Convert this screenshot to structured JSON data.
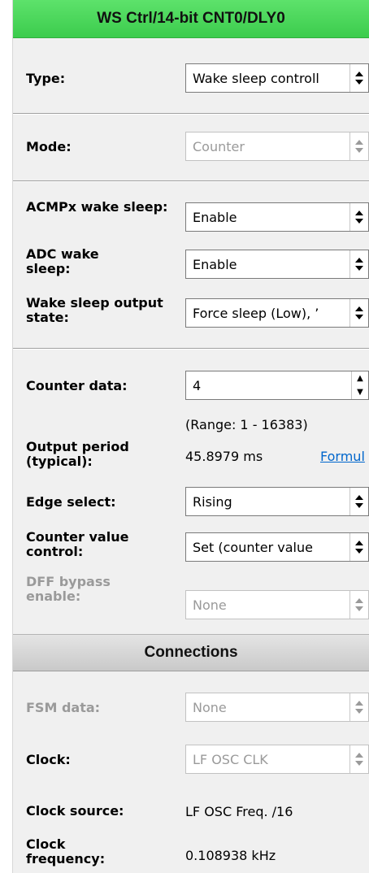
{
  "header": {
    "title": "WS Ctrl/14-bit CNT0/DLY0"
  },
  "type_row": {
    "label": "Type:",
    "value": "Wake sleep controll"
  },
  "mode_row": {
    "label": "Mode:",
    "value": "Counter"
  },
  "acmp_row": {
    "label": "ACMPx wake sleep:",
    "value": "Enable"
  },
  "adc_row": {
    "label": "ADC wake sleep:",
    "value": "Enable"
  },
  "output_state_row": {
    "label": "Wake sleep output state:",
    "value": "Force sleep (Low), ’"
  },
  "counter_data_row": {
    "label": "Counter data:",
    "value": "4",
    "range": "(Range:  1 - 16383)"
  },
  "output_period_row": {
    "label": "Output period (typical):",
    "value": "45.8979 ms",
    "link": "Formul"
  },
  "edge_select_row": {
    "label": "Edge select:",
    "value": "Rising"
  },
  "counter_value_row": {
    "label": "Counter value control:",
    "value": "Set (counter value"
  },
  "dff_row": {
    "label": "DFF bypass enable:",
    "value": "None"
  },
  "connections": {
    "title": "Connections"
  },
  "fsm_row": {
    "label": "FSM data:",
    "value": "None"
  },
  "clock_row": {
    "label": "Clock:",
    "value": "LF OSC CLK"
  },
  "clock_source_row": {
    "label": "Clock source:",
    "value": "LF OSC Freq. /16"
  },
  "clock_freq_row": {
    "label": "Clock frequency:",
    "value": "0.108938 kHz"
  },
  "icons": {
    "dropdown": "up-down-arrows-icon",
    "spinner": "spinner-arrows-icon"
  }
}
